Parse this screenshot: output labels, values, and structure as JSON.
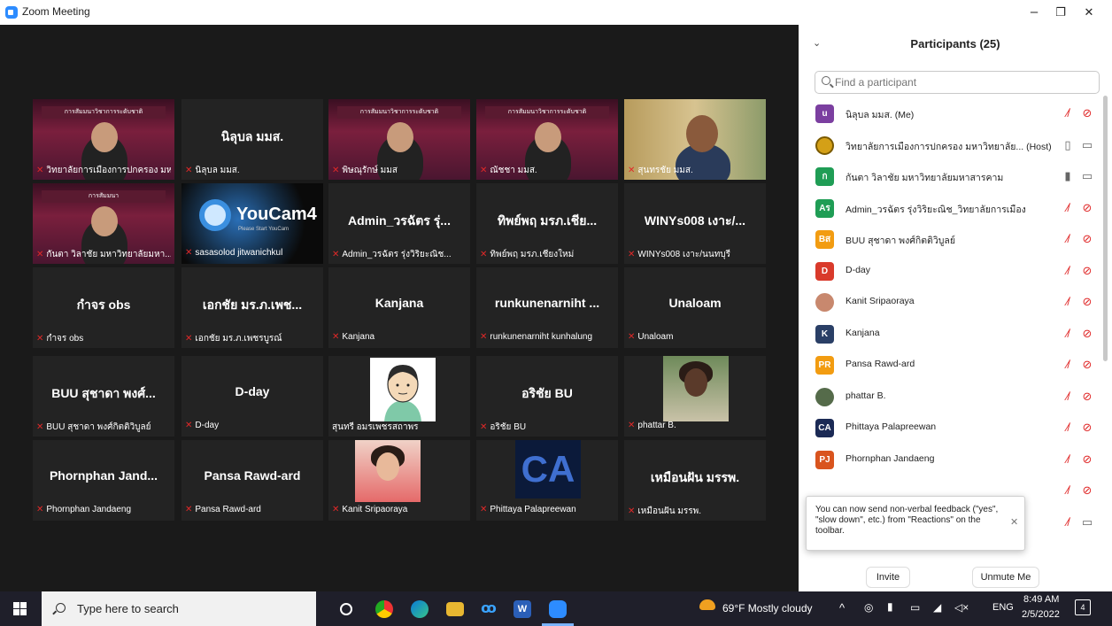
{
  "window": {
    "title": "Zoom Meeting",
    "min": "–",
    "restore": "❐",
    "close": "✕"
  },
  "video_tiles": [
    {
      "kind": "banner",
      "name": "วิทยาลัยการเมืองการปกครอง มห...",
      "banner_text": "การสัมมนาวิชาการระดับชาติ"
    },
    {
      "kind": "text",
      "big": "นิลุบล มมส.",
      "name": "นิลุบล มมส."
    },
    {
      "kind": "banner",
      "name": "พิษณุรักษ์ มมส",
      "banner_text": "การสัมมนาวิชาการระดับชาติ"
    },
    {
      "kind": "banner",
      "name": "ณัชชา มมส.",
      "banner_text": "การสัมมนาวิชาการระดับชาติ"
    },
    {
      "kind": "photo",
      "name": "สุนทรชัย มมส."
    },
    {
      "kind": "banner",
      "name": "กันตา วิลาชัย มหาวิทยาลัยมหา...",
      "banner_text": "การสัมมนา",
      "active": true
    },
    {
      "kind": "youcam",
      "name": "sasasolod jitwanichkul",
      "logo": "YouCam4",
      "sub": "Please Start YouCam"
    },
    {
      "kind": "text",
      "big": "Admin_วรฉัตร รุ่...",
      "name": "Admin_วรฉัตร รุ่งวิริยะณิช..."
    },
    {
      "kind": "text",
      "big": "ทิพย์พฤ มรภ.เชีย...",
      "name": "ทิพย์พฤ มรภ.เชียงใหม่"
    },
    {
      "kind": "text",
      "big": "WINYs008 เงาะ/...",
      "name": "WINYs008 เงาะ/นนทบุรี"
    },
    {
      "kind": "text",
      "big": "กำจร obs",
      "name": "กำจร obs"
    },
    {
      "kind": "text",
      "big": "เอกชัย มร.ภ.เพช...",
      "name": "เอกชัย มร.ภ.เพชรบูรณ์"
    },
    {
      "kind": "text",
      "big": "Kanjana",
      "name": "Kanjana"
    },
    {
      "kind": "text",
      "big": "runkunenarniht ...",
      "name": "runkunenarniht kunhalung"
    },
    {
      "kind": "text",
      "big": "Unaloam",
      "name": "Unaloam"
    },
    {
      "kind": "text",
      "big": "BUU สุชาดา พงศ์...",
      "name": "BUU สุชาดา พงศ์กิตติวิบูลย์"
    },
    {
      "kind": "text",
      "big": "D-day",
      "name": "D-day"
    },
    {
      "kind": "avatar",
      "name": "สุนทรี อมรเพชรสถาพร",
      "nomute": true
    },
    {
      "kind": "text",
      "big": "อริชัย BU",
      "name": "อริชัย BU"
    },
    {
      "kind": "portrait",
      "name": "phattar B."
    },
    {
      "kind": "text",
      "big": "Phornphan Jand...",
      "name": "Phornphan Jandaeng"
    },
    {
      "kind": "text",
      "big": "Pansa Rawd-ard",
      "name": "Pansa Rawd-ard"
    },
    {
      "kind": "portrait2",
      "name": "Kanit Sripaoraya"
    },
    {
      "kind": "ca",
      "name": "Phittaya Palapreewan",
      "logo": "CA"
    },
    {
      "kind": "text",
      "big": "เหมือนฝัน มรรพ.",
      "name": "เหมือนฝัน มรรพ."
    }
  ],
  "panel": {
    "title": "Participants (25)",
    "search_placeholder": "Find a participant",
    "participants": [
      {
        "initial": "u",
        "color": "#7b3fa0",
        "name": "นิลุบล มมส. (Me)",
        "mic": "muted",
        "cam": "off"
      },
      {
        "initial": "",
        "color": "#d4a017",
        "name": "วิทยาลัยการเมืองการปกครอง มหาวิทยาลัย... (Host)",
        "mic": "on",
        "cam": "on"
      },
      {
        "initial": "ก",
        "color": "#1f9d55",
        "name": "กันตา วิลาชัย  มหาวิทยาลัยมหาสารคาม",
        "mic": "active",
        "cam": "on"
      },
      {
        "initial": "Aร",
        "color": "#1f9d55",
        "name": "Admin_วรฉัตร รุ่งวิริยะณิช_วิทยาลัยการเมือง",
        "mic": "muted",
        "cam": "off"
      },
      {
        "initial": "Bส",
        "color": "#f29c11",
        "name": "BUU สุชาดา พงศ์กิตติวิบูลย์",
        "mic": "muted",
        "cam": "off"
      },
      {
        "initial": "D",
        "color": "#d93a2b",
        "name": "D-day",
        "mic": "muted",
        "cam": "off"
      },
      {
        "initial": "",
        "color": "#c8886e",
        "name": "Kanit Sripaoraya",
        "mic": "muted",
        "cam": "off"
      },
      {
        "initial": "K",
        "color": "#2a3f66",
        "name": "Kanjana",
        "mic": "muted",
        "cam": "off"
      },
      {
        "initial": "PR",
        "color": "#f29c11",
        "name": "Pansa Rawd-ard",
        "mic": "muted",
        "cam": "off"
      },
      {
        "initial": "",
        "color": "#556b4a",
        "name": "phattar B.",
        "mic": "muted",
        "cam": "off"
      },
      {
        "initial": "CA",
        "color": "#1b2a55",
        "name": "Phittaya Palapreewan",
        "mic": "muted",
        "cam": "off"
      },
      {
        "initial": "PJ",
        "color": "#d9541e",
        "name": "Phornphan Jandaeng",
        "mic": "muted",
        "cam": "off"
      },
      {
        "initial": "",
        "color": "#ffffff",
        "name": "",
        "mic": "muted",
        "cam": "off"
      },
      {
        "initial": "",
        "color": "#f29c11",
        "name": "sasasolod jitwanichkul",
        "mic": "muted",
        "cam": "on"
      }
    ],
    "tooltip": "You can now send non-verbal feedback (\"yes\", \"slow down\", etc.) from \"Reactions\" on the toolbar.",
    "invite": "Invite",
    "unmute": "Unmute Me"
  },
  "taskbar": {
    "search_placeholder": "Type here to search",
    "weather": "69°F  Mostly cloudy",
    "lang": "ENG",
    "time": "8:49 AM",
    "date": "2/5/2022",
    "notif_count": "4"
  },
  "icons": {
    "mic_muted": "🎤",
    "chevron": "⌄"
  }
}
